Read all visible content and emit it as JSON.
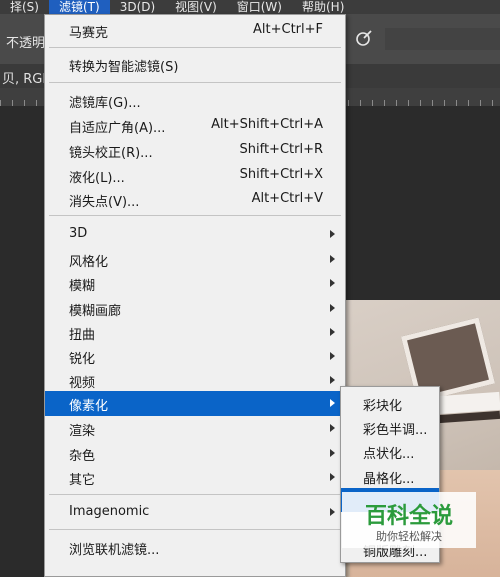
{
  "menubar": {
    "items": [
      "择(S)",
      "滤镜(T)",
      "3D(D)",
      "视图(V)",
      "窗口(W)",
      "帮助(H)"
    ],
    "active_index": 1
  },
  "options_bar": {
    "opacity_label": "不透明",
    "flow_icon": "airbrush-icon"
  },
  "document_tab": {
    "label": "贝, RGI"
  },
  "filter_menu": {
    "items": [
      {
        "label": "马赛克",
        "shortcut": "Alt+Ctrl+F"
      },
      {
        "label": "转换为智能滤镜(S)"
      },
      {
        "label": "滤镜库(G)..."
      },
      {
        "label": "自适应广角(A)...",
        "shortcut": "Alt+Shift+Ctrl+A"
      },
      {
        "label": "镜头校正(R)...",
        "shortcut": "Shift+Ctrl+R"
      },
      {
        "label": "液化(L)...",
        "shortcut": "Shift+Ctrl+X"
      },
      {
        "label": "消失点(V)...",
        "shortcut": "Alt+Ctrl+V"
      },
      {
        "label": "3D",
        "submenu": true
      },
      {
        "label": "风格化",
        "submenu": true
      },
      {
        "label": "模糊",
        "submenu": true
      },
      {
        "label": "模糊画廊",
        "submenu": true
      },
      {
        "label": "扭曲",
        "submenu": true
      },
      {
        "label": "锐化",
        "submenu": true
      },
      {
        "label": "视频",
        "submenu": true
      },
      {
        "label": "像素化",
        "submenu": true,
        "highlighted": true
      },
      {
        "label": "渲染",
        "submenu": true
      },
      {
        "label": "杂色",
        "submenu": true
      },
      {
        "label": "其它",
        "submenu": true
      },
      {
        "label": "Imagenomic",
        "submenu": true
      },
      {
        "label": "浏览联机滤镜..."
      }
    ]
  },
  "pixelate_submenu": {
    "items": [
      "彩块化",
      "彩色半调...",
      "点状化...",
      "晶格化...",
      "",
      "铜版雕刻..."
    ],
    "highlighted_index": 4
  },
  "watermark": {
    "title": "百科全说",
    "subtitle": "助你轻松解决"
  },
  "colors": {
    "highlight": "#0a64c8",
    "menu_bg": "#f0f0f0",
    "watermark_green": "#2b9b3c"
  }
}
